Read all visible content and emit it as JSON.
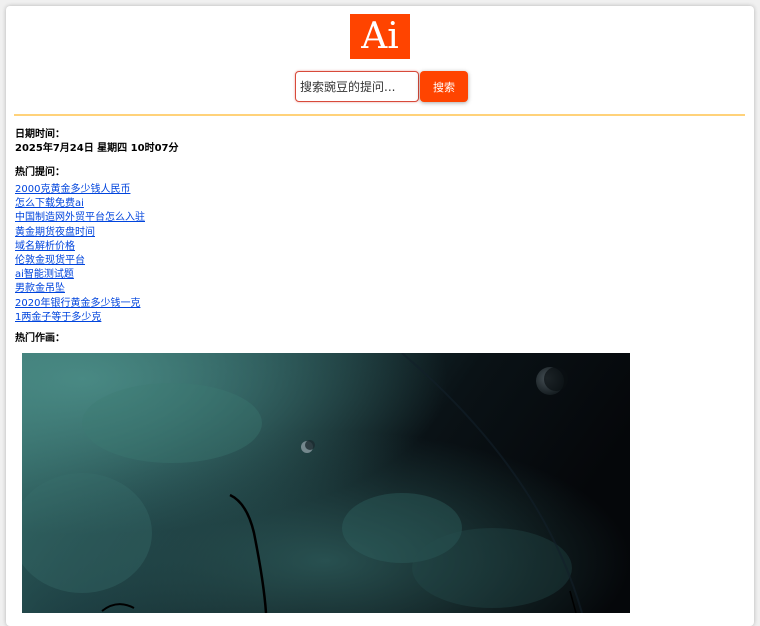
{
  "header": {
    "logo_text": "Ai"
  },
  "search": {
    "placeholder": "搜索豌豆的提问...",
    "button_label": "搜索"
  },
  "datetime": {
    "label": "日期时间：",
    "value": "2025年7月24日 星期四 10时07分"
  },
  "hot_questions": {
    "label": "热门提问：",
    "items": [
      "2000克黄金多少钱人民币",
      "怎么下载免费ai",
      "中国制造网外贸平台怎么入驻",
      "黄金期货夜盘时间",
      "域名解析价格",
      "伦敦金现货平台",
      "ai智能测试题",
      "男款金吊坠",
      "2020年银行黄金多少钱一克",
      "1两金子等于多少克"
    ]
  },
  "hot_artworks": {
    "label": "热门作画："
  },
  "colors": {
    "brand": "#ff4400",
    "link": "#0044dd",
    "divider": "#ffd27a"
  }
}
